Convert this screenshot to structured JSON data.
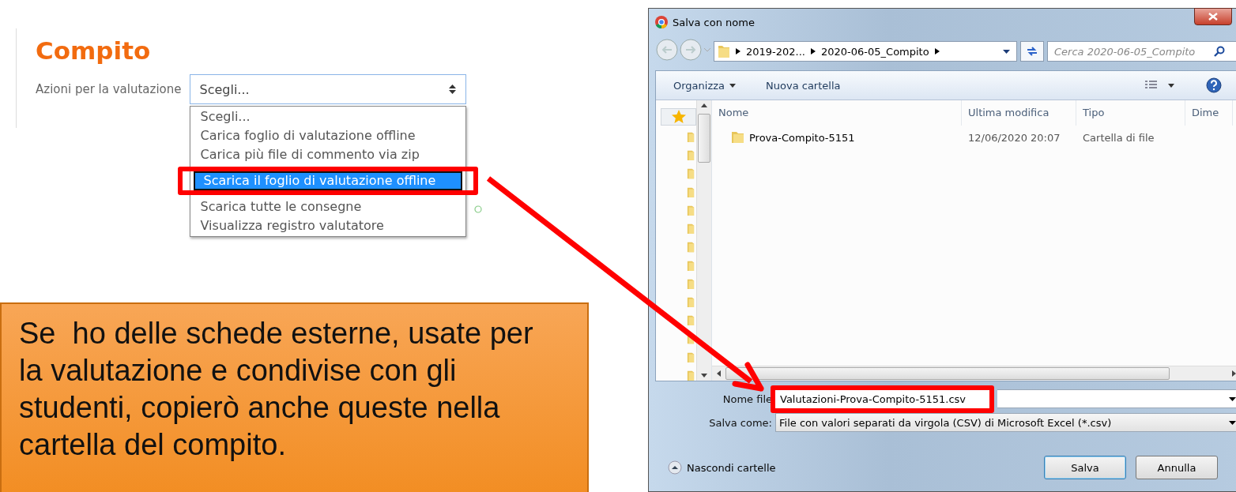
{
  "assignment": {
    "title": "Compito",
    "label": "Azioni per la valutazione",
    "select_value": "Scegli...",
    "options": [
      {
        "label": "Scegli...",
        "selected": false
      },
      {
        "label": "Carica foglio di valutazione offline",
        "selected": false
      },
      {
        "label": "Carica più file di commento via zip",
        "selected": false
      },
      {
        "label": "Scarica il foglio di valutazione offline",
        "selected": true
      },
      {
        "label": "Scarica tutte le consegne",
        "selected": false
      },
      {
        "label": "Visualizza registro valutatore",
        "selected": false
      }
    ]
  },
  "callout": {
    "text": "Se  ho delle schede esterne, usate per la valutazione e condivise con gli studenti, copierò anche queste nella cartella del compito."
  },
  "dialog": {
    "title": "Salva con nome",
    "breadcrumb": [
      "2019-202...",
      "2020-06-05_Compito"
    ],
    "search_placeholder": "Cerca 2020-06-05_Compito",
    "toolbar": [
      "Organizza",
      "Nuova cartella"
    ],
    "columns": [
      "Nome",
      "Ultima modifica",
      "Tipo",
      "Dime"
    ],
    "rows": [
      {
        "name": "Prova-Compito-5151",
        "modified": "12/06/2020 20:07",
        "type": "Cartella di file"
      }
    ],
    "filename_label": "Nome file",
    "filename": "Valutazioni-Prova-Compito-5151.csv",
    "savetype_label": "Salva come:",
    "savetype": "File con valori separati da virgola (CSV) di Microsoft Excel (*.csv)",
    "hide_folders": "Nascondi cartelle",
    "buttons": [
      "Salva",
      "Annulla"
    ]
  }
}
